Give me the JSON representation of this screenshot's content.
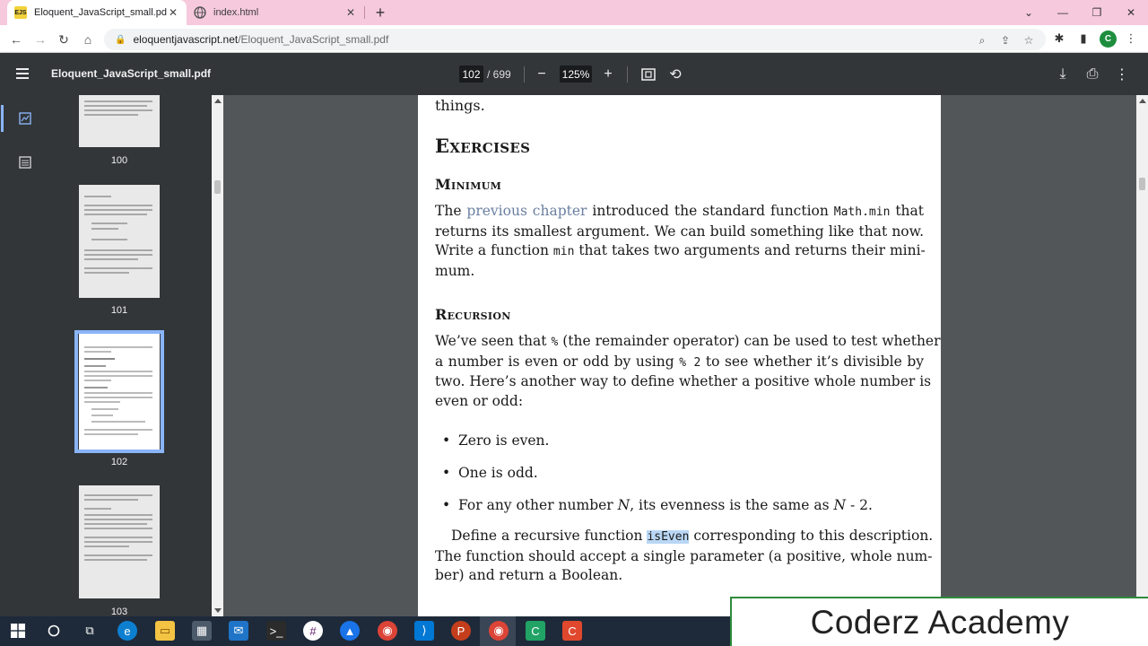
{
  "browser": {
    "tabs": [
      {
        "title": "Eloquent_JavaScript_small.pdf",
        "favicon": "EJS",
        "active": true
      },
      {
        "title": "index.html",
        "active": false
      }
    ],
    "url_domain": "eloquentjavascript.net",
    "url_path": "/Eloquent_JavaScript_small.pdf",
    "profile_initial": "C"
  },
  "pdf_toolbar": {
    "title": "Eloquent_JavaScript_small.pdf",
    "current_page": "102",
    "total_pages": "/ 699",
    "zoom": "125%"
  },
  "thumbnails": [
    {
      "label": "100"
    },
    {
      "label": "101"
    },
    {
      "label": "102",
      "selected": true
    },
    {
      "label": "103"
    }
  ],
  "document": {
    "prev_text": "things.",
    "heading": "Exercises",
    "minimum": {
      "title": "Minimum",
      "l1_a": "The ",
      "l1_link": "previous chapter",
      "l1_b": " introduced the standard function ",
      "l1_code": "Math.min",
      "l1_c": " that",
      "l2": "returns its smallest argument.  We can build something like that now.",
      "l3_a": "Write a function ",
      "l3_code": "min",
      "l3_b": " that takes two arguments and returns their mini-",
      "l4": "mum."
    },
    "recursion": {
      "title": "Recursion",
      "l1_a": "We’ve seen that ",
      "l1_code": "%",
      "l1_b": " (the remainder operator) can be used to test whether",
      "l2_a": "a number is even or odd by using ",
      "l2_code": "% 2",
      "l2_b": " to see whether it’s divisible by",
      "l3": "two.  Here’s another way to define whether a positive whole number is",
      "l4": "even or odd:",
      "bullet1": "Zero is even.",
      "bullet2": "One is odd.",
      "bullet3_a": "For any other number ",
      "bullet3_n": "N",
      "bullet3_b": ", its evenness is the same as ",
      "bullet3_n2": "N",
      "bullet3_c": " - 2.",
      "p2_l1_a": "Define a recursive function ",
      "p2_l1_code": "isEven",
      "p2_l1_b": " corresponding to this description.",
      "p2_l2": "The function should accept a single parameter (a positive, whole num-",
      "p2_l3": "ber) and return a Boolean."
    }
  },
  "overlay": {
    "brand": "Coderz Academy"
  }
}
